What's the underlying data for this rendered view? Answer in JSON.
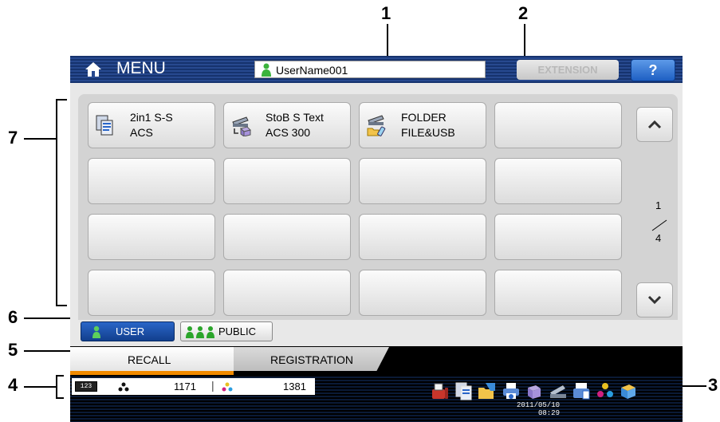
{
  "callouts": [
    "1",
    "2",
    "3",
    "4",
    "5",
    "6",
    "7"
  ],
  "header": {
    "menu_label": "MENU",
    "home_icon": "home-icon",
    "username": "UserName001",
    "extension_label": "EXTENSION",
    "help_label": "?"
  },
  "templates": [
    {
      "line1": "2in1 S-S",
      "line2": "ACS",
      "icon": "copy-template-icon"
    },
    {
      "line1": "StoB S Text",
      "line2": "ACS 300",
      "icon": "scan-to-box-icon"
    },
    {
      "line1": "FOLDER",
      "line2": "FILE&USB",
      "icon": "scan-to-folder-icon"
    }
  ],
  "pager": {
    "current": "1",
    "total": "4"
  },
  "filter": {
    "user_label": "USER",
    "public_label": "PUBLIC"
  },
  "tabs": {
    "recall": "RECALL",
    "registration": "REGISTRATION"
  },
  "counter": {
    "icon": "counter-icon",
    "black_count": "1171",
    "separator": "|",
    "color_count": "1381"
  },
  "status_icons": [
    "fax-icon",
    "copy-icon",
    "folder-icon",
    "print-icon",
    "box-icon",
    "scan-icon",
    "printer-queue-icon",
    "toner-icon",
    "network-icon"
  ],
  "clock": {
    "date": "2011/05/10",
    "time": "08:29"
  },
  "colors": {
    "menubar": "#1f3f80",
    "accent_tab": "#f08a00",
    "help": "#2d6fd0",
    "user_button": "#1c4fa8"
  }
}
